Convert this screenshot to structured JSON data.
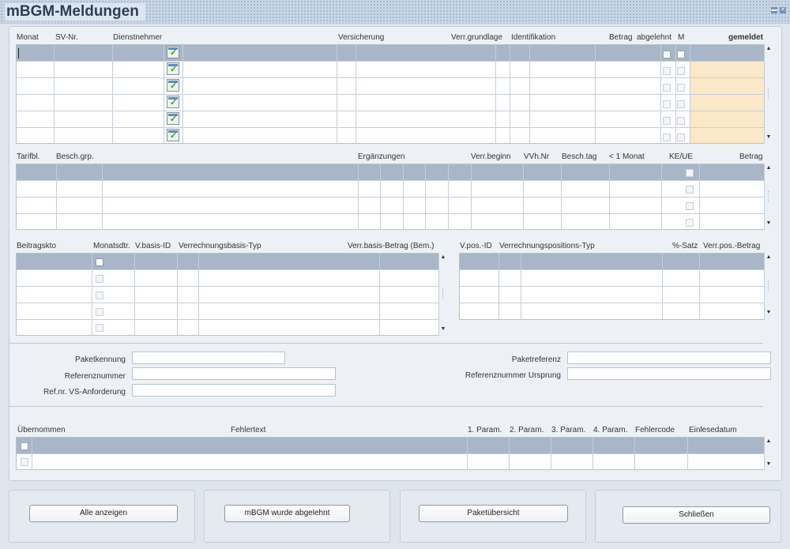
{
  "window": {
    "title": "mBGM-Meldungen",
    "minimize_glyph": "▬",
    "close_glyph": "✕"
  },
  "meldungen": {
    "headers": [
      "Monat",
      "SV-Nr.",
      "Dienstnehmer",
      "Versicherung",
      "Verr.grundlage",
      "Identifikation",
      "Betrag",
      "abgelehnt",
      "M",
      "gemeldet"
    ],
    "rows": 6,
    "check_icon": "document-check-icon",
    "gemeldet_color": "#fbe8c8"
  },
  "tarif": {
    "headers": [
      "Tarifbl.",
      "Besch.grp.",
      "Ergänzungen",
      "Verr.beginn",
      "VVh.Nr",
      "Besch.tag",
      "< 1 Monat",
      "KE/UE",
      "Betrag"
    ],
    "rows": 4
  },
  "beitrag": {
    "headers": [
      "Beitragskto",
      "Monatsdtr.",
      "V.basis-ID",
      "Verrechnungsbasis-Typ",
      "Verr.basis-Betrag (Bem.)"
    ],
    "rows": 5
  },
  "verrpos": {
    "headers": [
      "V.pos.-ID",
      "Verrechnungspositions-Typ",
      "%-Satz",
      "Verr.pos.-Betrag"
    ],
    "rows": 4
  },
  "paket": {
    "paketkennung_label": "Paketkennung",
    "paketkennung_value": "",
    "referenznummer_label": "Referenznummer",
    "referenznummer_value": "",
    "refnr_vs_label": "Ref.nr. VS-Anforderung",
    "refnr_vs_value": "",
    "paketreferenz_label": "Paketreferenz",
    "paketreferenz_value": "",
    "refnr_ursprung_label": "Referenznummer Ursprung",
    "refnr_ursprung_value": ""
  },
  "fehler": {
    "headers": [
      "Übernommen",
      "Fehlertext",
      "1. Param.",
      "2. Param.",
      "3. Param.",
      "4. Param.",
      "Fehlercode",
      "Einlesedatum"
    ],
    "rows": 2
  },
  "buttons": {
    "alle_anzeigen": "Alle anzeigen",
    "abgelehnt": "mBGM wurde abgelehnt",
    "paketuebersicht": "Paketübersicht",
    "schliessen": "Schließen"
  },
  "scroll": {
    "up": "▲",
    "down": "▼"
  },
  "check_glyph": "✓"
}
